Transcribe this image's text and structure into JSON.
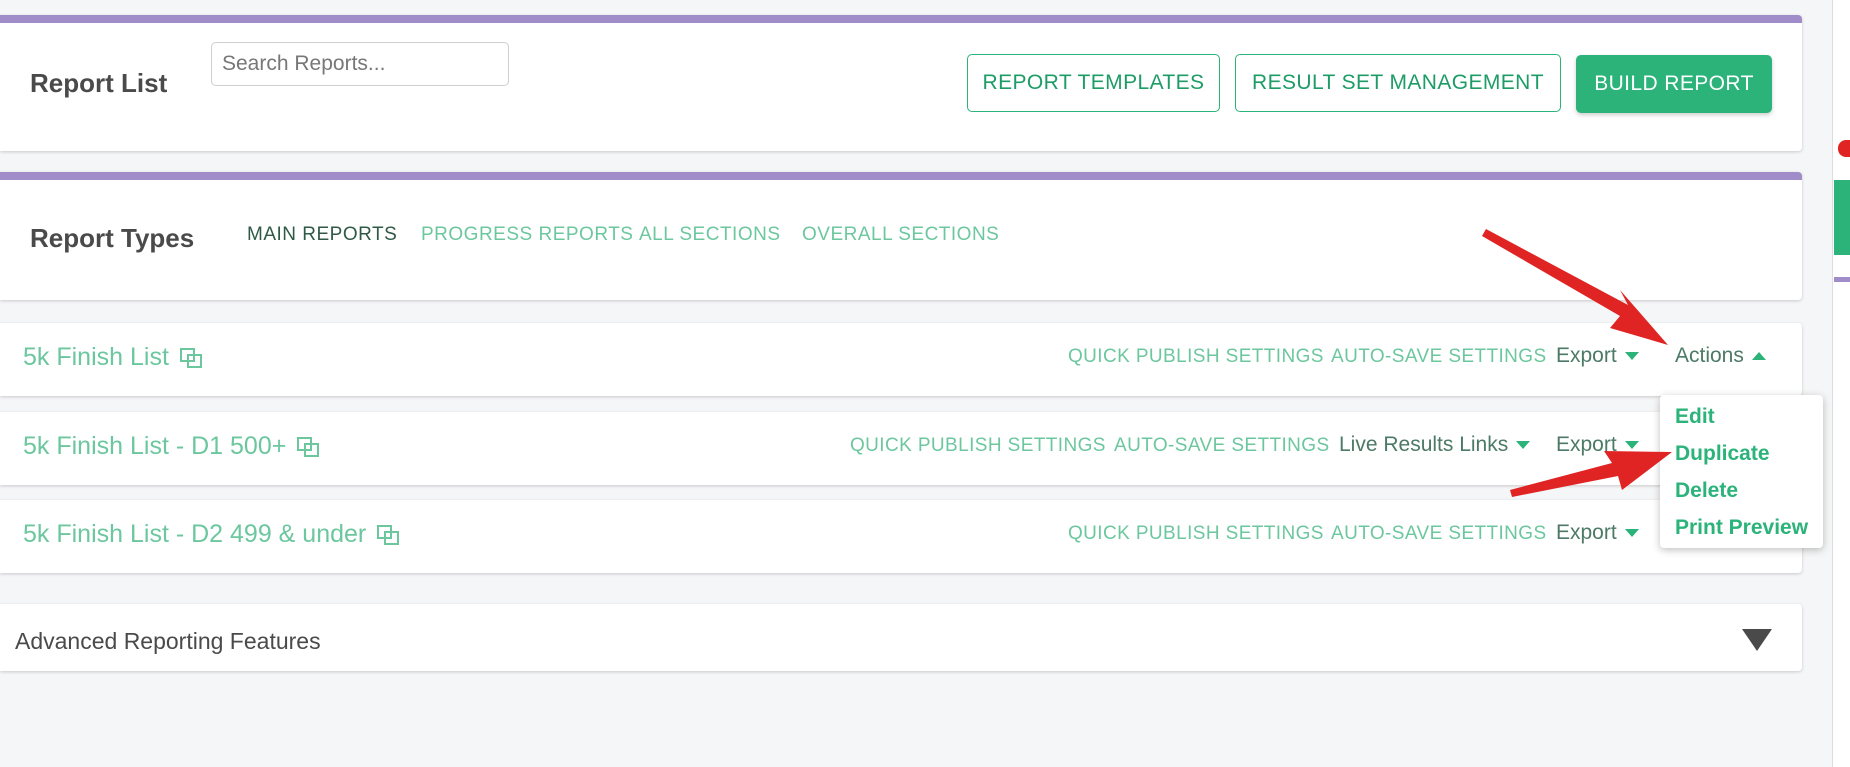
{
  "header": {
    "title": "Report List",
    "search_placeholder": "Search Reports...",
    "buttons": {
      "templates": "REPORT TEMPLATES",
      "result_sets": "RESULT SET MANAGEMENT",
      "build": "BUILD REPORT"
    }
  },
  "report_types": {
    "title": "Report Types",
    "tabs": [
      "MAIN REPORTS",
      "PROGRESS REPORTS",
      "ALL SECTIONS",
      "OVERALL SECTIONS"
    ],
    "active_tab": "MAIN REPORTS"
  },
  "reports": [
    {
      "name": "5k Finish List",
      "quick_publish": "QUICK PUBLISH SETTINGS",
      "auto_save": "AUTO-SAVE SETTINGS",
      "export": "Export",
      "actions": "Actions"
    },
    {
      "name": "5k Finish List - D1 500+",
      "quick_publish": "QUICK PUBLISH SETTINGS",
      "auto_save": "AUTO-SAVE SETTINGS",
      "live_results": "Live Results Links",
      "export": "Export"
    },
    {
      "name": "5k Finish List - D2 499 & under",
      "quick_publish": "QUICK PUBLISH SETTINGS",
      "auto_save": "AUTO-SAVE SETTINGS",
      "export": "Export"
    }
  ],
  "actions_menu": {
    "items": [
      "Edit",
      "Duplicate",
      "Delete",
      "Print Preview"
    ]
  },
  "advanced": {
    "title": "Advanced Reporting Features"
  },
  "colors": {
    "accent": "#2bb37a",
    "purple_bar": "#a08cc8",
    "annotation_arrow": "#e02424"
  }
}
